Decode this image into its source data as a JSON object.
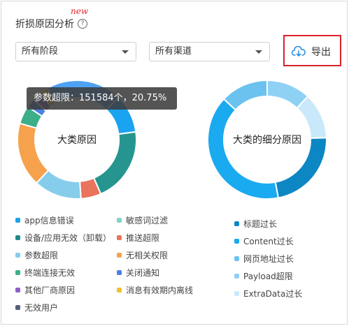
{
  "header": {
    "new_badge": "new",
    "title": "折损原因分析",
    "help_icon": "question-circle-icon"
  },
  "filters": {
    "stage_select": "所有阶段",
    "channel_select": "所有渠道"
  },
  "export": {
    "label": "导出",
    "icon": "cloud-download-icon"
  },
  "tooltip": {
    "text": "参数超限：151584个，20.75%"
  },
  "chart_data": [
    {
      "type": "pie",
      "title": "大类原因",
      "center_label": "大类原因",
      "slices": [
        {
          "label": "参数超限",
          "value": 20.75,
          "color": "#4ea1f3"
        },
        {
          "label": "app信息错误",
          "value": 10.5,
          "color": "#1aa3f0"
        },
        {
          "label": "设备/应用无效（卸载）",
          "value": 20.5,
          "color": "#26958f"
        },
        {
          "label": "推送超限",
          "value": 5.5,
          "color": "#e9735b"
        },
        {
          "label": "参数超限",
          "value": 13.0,
          "color": "#86cdec"
        },
        {
          "label": "无相关权限",
          "value": 17.5,
          "color": "#f6a24d"
        },
        {
          "label": "终端连接无效",
          "value": 5.0,
          "color": "#3daf88"
        },
        {
          "label": "关闭通知",
          "value": 2.5,
          "color": "#4a7fe8"
        },
        {
          "label": "其他厂商原因",
          "value": 2.5,
          "color": "#8f5fc9"
        },
        {
          "label": "消息有效期内离线",
          "value": 2.25,
          "color": "#f2c02c"
        }
      ]
    },
    {
      "type": "pie",
      "title": "大类的细分原因",
      "center_label": "大类的细分原因",
      "slices": [
        {
          "label": "Payload超限",
          "value": 12.0,
          "color": "#8fd1f5"
        },
        {
          "label": "ExtraData过长",
          "value": 12.5,
          "color": "#c9e9fb"
        },
        {
          "label": "标题过长",
          "value": 22.5,
          "color": "#0d86c4"
        },
        {
          "label": "Content过长",
          "value": 40.0,
          "color": "#1aaaf0"
        },
        {
          "label": "网页地址过长",
          "value": 13.0,
          "color": "#6cc2ef"
        }
      ]
    }
  ],
  "legend_left": [
    {
      "label": "app信息错误",
      "color": "#1aa3f0"
    },
    {
      "label": "敏感词过滤",
      "color": "#7fd6c8"
    },
    {
      "label": "设备/应用无效（卸载）",
      "color": "#1f8b8a"
    },
    {
      "label": "推送超限",
      "color": "#e9735b"
    },
    {
      "label": "参数超限",
      "color": "#86cdec"
    },
    {
      "label": "无相关权限",
      "color": "#f6a24d"
    },
    {
      "label": "终端连接无效",
      "color": "#3daf88"
    },
    {
      "label": "关闭通知",
      "color": "#4a7fe8"
    },
    {
      "label": "其他厂商原因",
      "color": "#8f5fc9"
    },
    {
      "label": "消息有效期内离线",
      "color": "#f2c02c"
    },
    {
      "label": "无效用户",
      "color": "#54607a"
    }
  ],
  "legend_right": [
    {
      "label": "标题过长",
      "color": "#0d86c4"
    },
    {
      "label": "Content过长",
      "color": "#1aaaf0"
    },
    {
      "label": "网页地址过长",
      "color": "#6cc2ef"
    },
    {
      "label": "Payload超限",
      "color": "#8fd1f5"
    },
    {
      "label": "ExtraData过长",
      "color": "#c9e9fb"
    }
  ]
}
